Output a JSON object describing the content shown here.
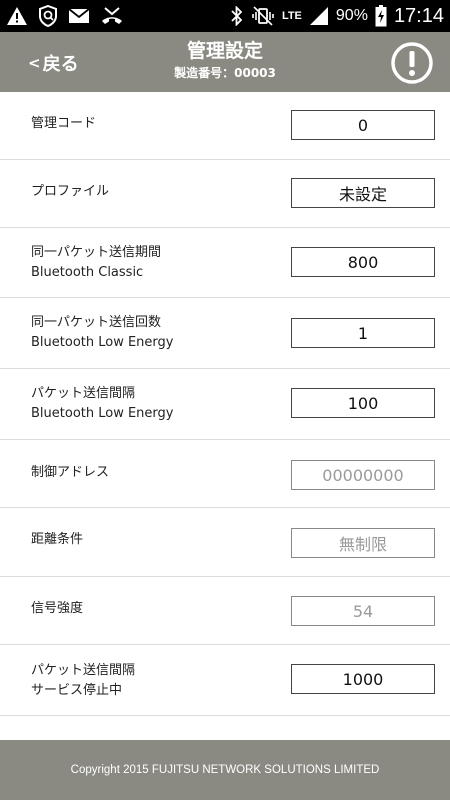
{
  "status_bar": {
    "battery_percent": "90%",
    "network_type": "LTE",
    "time": "17:14",
    "left_icons": [
      "warning-icon",
      "security-shield-icon",
      "mail-icon",
      "missed-call-icon"
    ],
    "right_icons": [
      "bluetooth-icon",
      "vibrate-icon",
      "lte-icon",
      "signal-icon",
      "battery-charging-icon"
    ]
  },
  "header": {
    "back_label": "戻る",
    "back_chevron": "<",
    "title": "管理設定",
    "serial_label": "製造番号：",
    "serial_value": "00003",
    "alert_icon": "exclamation-circle-icon"
  },
  "rows": [
    {
      "label1": "管理コード",
      "label2": "",
      "value": "0",
      "editable": true
    },
    {
      "label1": "プロファイル",
      "label2": "",
      "value": "未設定",
      "editable": true
    },
    {
      "label1": "同一パケット送信期間",
      "label2": "Bluetooth Classic",
      "value": "800",
      "editable": true
    },
    {
      "label1": "同一パケット送信回数",
      "label2": "Bluetooth Low Energy",
      "value": "1",
      "editable": true
    },
    {
      "label1": "パケット送信間隔",
      "label2": "Bluetooth Low Energy",
      "value": "100",
      "editable": true
    },
    {
      "label1": "制御アドレス",
      "label2": "",
      "value": "00000000",
      "editable": false
    },
    {
      "label1": "距離条件",
      "label2": "",
      "value": "無制限",
      "editable": false
    },
    {
      "label1": "信号強度",
      "label2": "",
      "value": "54",
      "editable": false
    },
    {
      "label1": "パケット送信間隔",
      "label2": "サービス停止中",
      "value": "1000",
      "editable": true
    }
  ],
  "footer": {
    "copyright": "Copyright 2015 FUJITSU NETWORK SOLUTIONS LIMITED"
  },
  "colors": {
    "header_bg": "#8a8a82",
    "status_bar_bg": "#000000",
    "field_border": "#444444",
    "disabled_text": "#9a9a9a"
  }
}
